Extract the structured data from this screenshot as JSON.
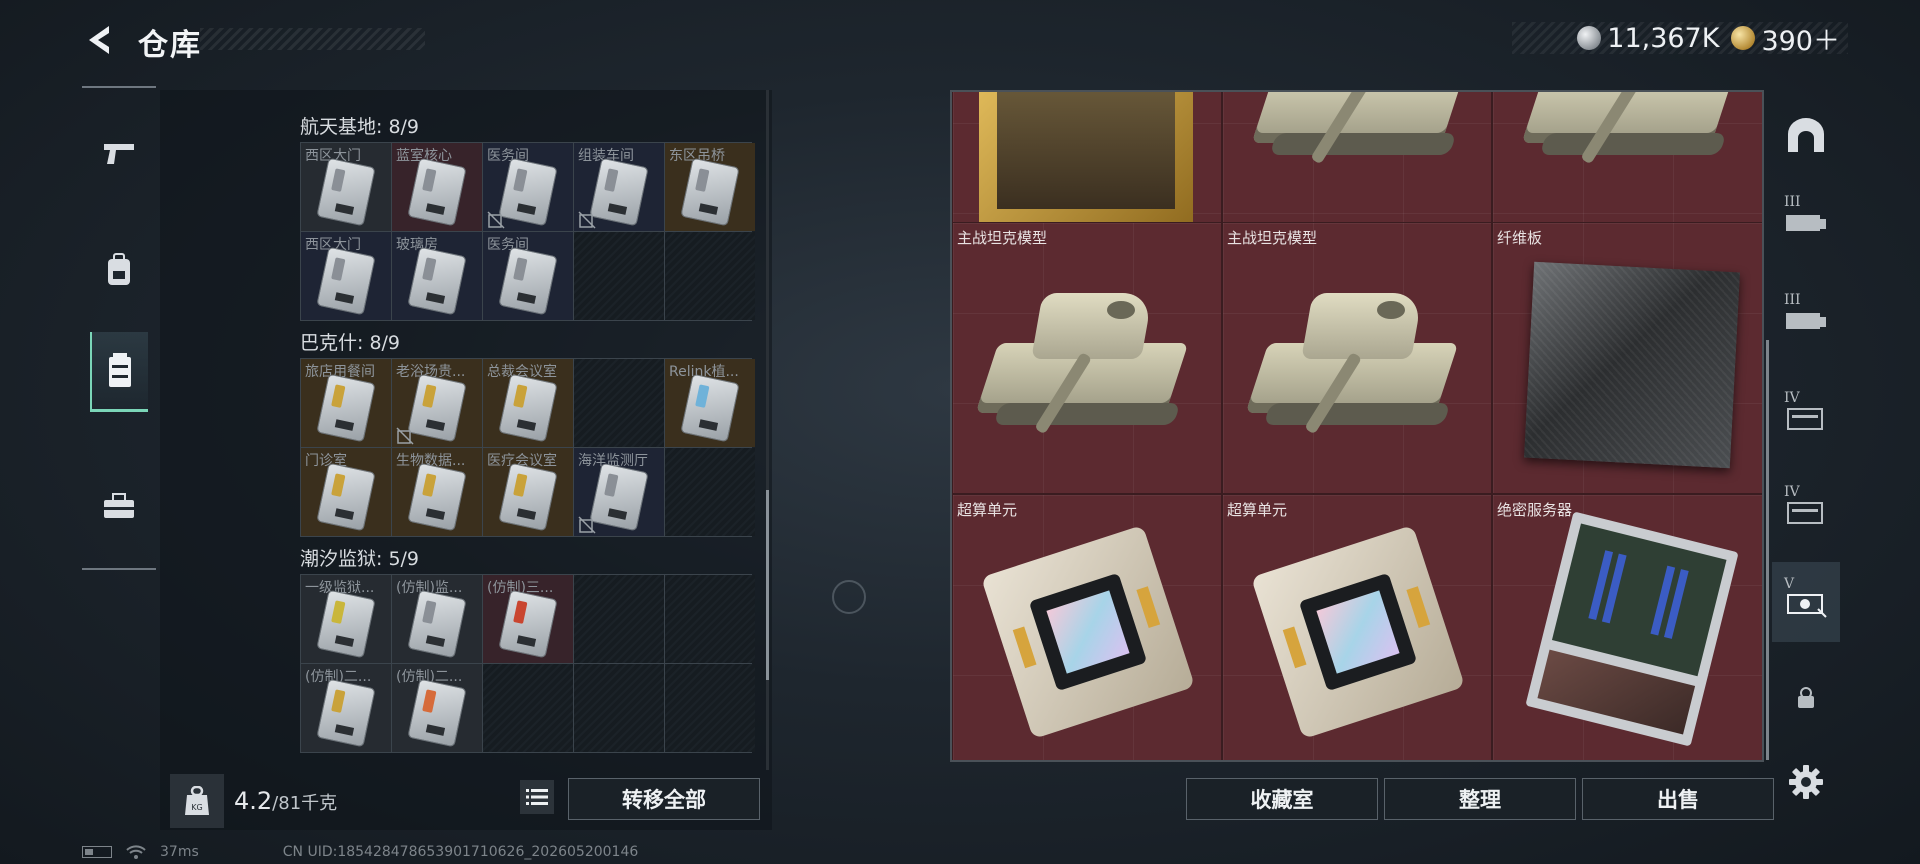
{
  "header": {
    "title": "仓库",
    "currencies": [
      {
        "icon": "silver-coin-icon",
        "value": "11,367K"
      },
      {
        "icon": "gold-coin-icon",
        "value": "390＋"
      }
    ]
  },
  "left_nav": [
    {
      "icon": "pistol-icon",
      "active": false
    },
    {
      "icon": "backpack-icon",
      "active": false
    },
    {
      "icon": "storage-box-icon",
      "active": true
    },
    {
      "icon": "toolbox-icon",
      "active": false
    }
  ],
  "sections": [
    {
      "title": "航天基地: 8/9",
      "cells": [
        {
          "label": "西区大门",
          "rarity": "gray",
          "stripe": "#8a8f96",
          "nodrop": false
        },
        {
          "label": "蓝室核心",
          "rarity": "red",
          "stripe": "#8a8f96",
          "nodrop": false
        },
        {
          "label": "医务间",
          "rarity": "blue",
          "stripe": "#8a8f96",
          "nodrop": true
        },
        {
          "label": "组装车间",
          "rarity": "blue",
          "stripe": "#8a8f96",
          "nodrop": true
        },
        {
          "label": "东区吊桥",
          "rarity": "gold",
          "stripe": "#8a8f96",
          "nodrop": false
        },
        {
          "label": "西区大门",
          "rarity": "blue",
          "stripe": "#8a8f96",
          "nodrop": false
        },
        {
          "label": "玻璃房",
          "rarity": "blue",
          "stripe": "#8a8f96",
          "nodrop": false
        },
        {
          "label": "医务间",
          "rarity": "blue",
          "stripe": "#8a8f96",
          "nodrop": false
        },
        {
          "label": "",
          "rarity": "empty"
        },
        {
          "label": "",
          "rarity": "empty"
        }
      ]
    },
    {
      "title": "巴克什: 8/9",
      "cells": [
        {
          "label": "旅店用餐间",
          "rarity": "gold",
          "stripe": "#c9a23a",
          "nodrop": false
        },
        {
          "label": "老浴场贵...",
          "rarity": "gold",
          "stripe": "#c9a23a",
          "nodrop": true
        },
        {
          "label": "总裁会议室",
          "rarity": "gold",
          "stripe": "#c9a23a",
          "nodrop": false
        },
        {
          "label": "",
          "rarity": "empty"
        },
        {
          "label": "Relink植...",
          "rarity": "gold",
          "stripe": "#6fb2d9",
          "nodrop": false
        },
        {
          "label": "门诊室",
          "rarity": "gold",
          "stripe": "#c9a23a",
          "nodrop": false
        },
        {
          "label": "生物数据...",
          "rarity": "gold",
          "stripe": "#c9a23a",
          "nodrop": false
        },
        {
          "label": "医疗会议室",
          "rarity": "gold",
          "stripe": "#c9a23a",
          "nodrop": false
        },
        {
          "label": "海洋监测厅",
          "rarity": "blue",
          "stripe": "#8a8f96",
          "nodrop": true
        },
        {
          "label": "",
          "rarity": "empty"
        }
      ]
    },
    {
      "title": "潮汐监狱: 5/9",
      "cells": [
        {
          "label": "一级监狱...",
          "rarity": "gray",
          "stripe": "#c9b63a",
          "nodrop": false
        },
        {
          "label": "(仿制)监...",
          "rarity": "gray",
          "stripe": "#8a8f96",
          "nodrop": false
        },
        {
          "label": "(仿制)三...",
          "rarity": "red",
          "stripe": "#c9452f",
          "nodrop": false
        },
        {
          "label": "",
          "rarity": "empty"
        },
        {
          "label": "",
          "rarity": "empty"
        },
        {
          "label": "(仿制)二...",
          "rarity": "gray",
          "stripe": "#c9a23a",
          "nodrop": false
        },
        {
          "label": "(仿制)二...",
          "rarity": "gray",
          "stripe": "#d66b3a",
          "nodrop": false
        },
        {
          "label": "",
          "rarity": "empty"
        },
        {
          "label": "",
          "rarity": "empty"
        },
        {
          "label": "",
          "rarity": "empty"
        }
      ]
    }
  ],
  "left_footer": {
    "weight_main": "4.2",
    "weight_rest": "/81千克",
    "transfer_all": "转移全部"
  },
  "right_items": [
    {
      "label": "",
      "art": "painting"
    },
    {
      "label": "",
      "art": "tank-partial"
    },
    {
      "label": "",
      "art": "tank-partial"
    },
    {
      "label": "主战坦克模型",
      "art": "tank"
    },
    {
      "label": "主战坦克模型",
      "art": "tank"
    },
    {
      "label": "纤维板",
      "art": "carbon-panel"
    },
    {
      "label": "超算单元",
      "art": "board"
    },
    {
      "label": "超算单元",
      "art": "board"
    },
    {
      "label": "绝密服务器",
      "art": "server"
    }
  ],
  "right_footer": {
    "collection": "收藏室",
    "organize": "整理",
    "sell": "出售"
  },
  "right_categories": [
    {
      "icon": "arch-icon",
      "roman": ""
    },
    {
      "icon": "tier-3-storage-icon",
      "roman": "III"
    },
    {
      "icon": "tier-3-storage-alt-icon",
      "roman": "III"
    },
    {
      "icon": "tier-4-storage-icon",
      "roman": "IV"
    },
    {
      "icon": "tier-4-storage-alt-icon",
      "roman": "IV"
    },
    {
      "icon": "tier-5-storage-icon",
      "roman": "V"
    },
    {
      "icon": "lock-icon",
      "roman": ""
    }
  ],
  "status_bar": {
    "ping": "37ms",
    "uid": "CN UID:185428478653901710626_202605200146"
  }
}
